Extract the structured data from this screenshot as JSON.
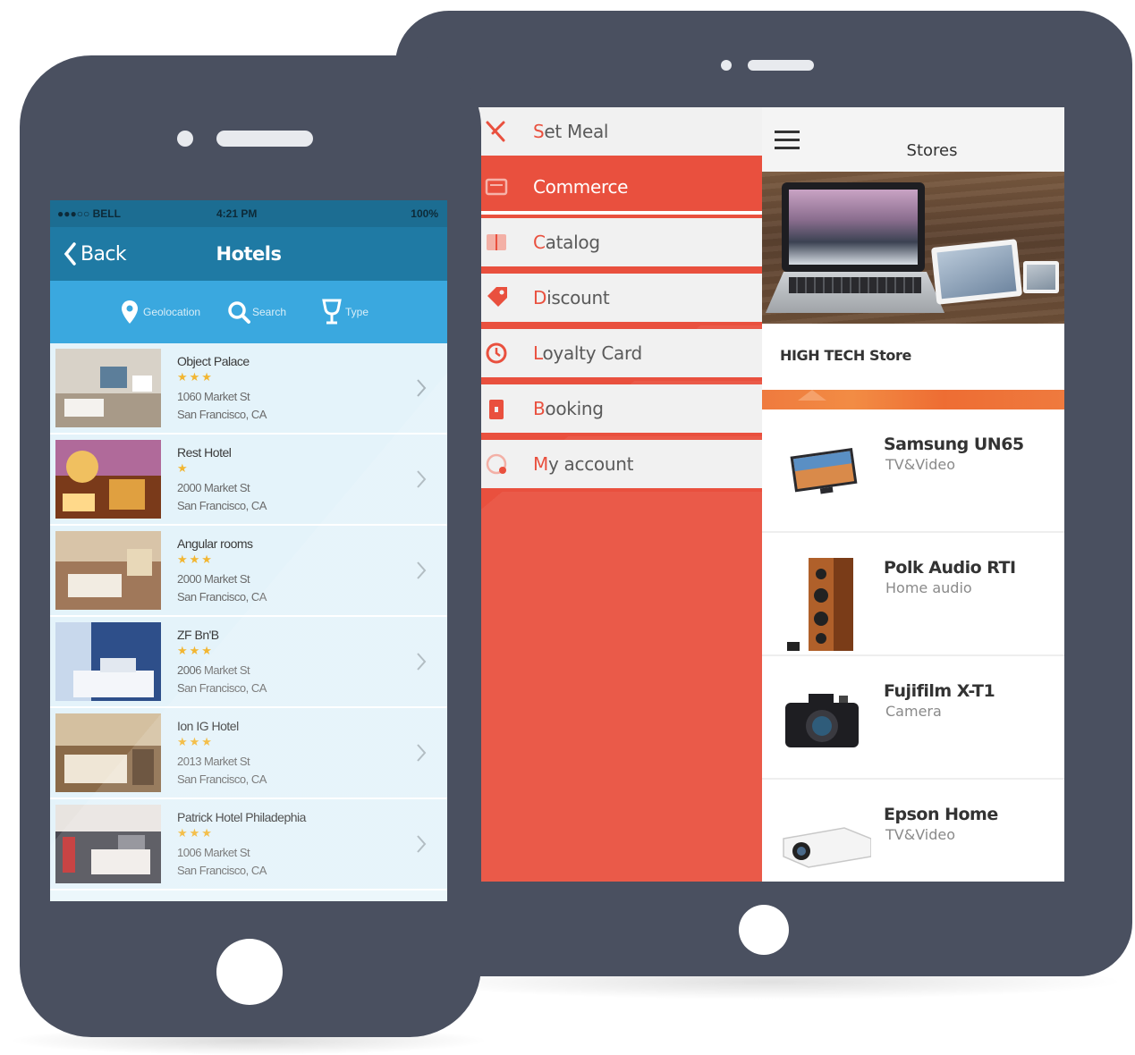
{
  "tablet": {
    "menu": {
      "items": [
        {
          "label": "Set Meal",
          "icon": "fork-knife-icon",
          "active": false
        },
        {
          "label": "Commerce",
          "icon": "cart-icon",
          "active": true
        },
        {
          "label": "Catalog",
          "icon": "book-icon",
          "active": false
        },
        {
          "label": "Discount",
          "icon": "tag-icon",
          "active": false
        },
        {
          "label": "Loyalty Card",
          "icon": "clock-icon",
          "active": false
        },
        {
          "label": "Booking",
          "icon": "calendar-icon",
          "active": false
        },
        {
          "label": "My account",
          "icon": "user-icon",
          "active": false
        }
      ]
    },
    "store": {
      "title": "Stores",
      "store_name": "HIGH TECH Store",
      "products": [
        {
          "name": "Samsung UN65",
          "category": "TV&Video",
          "icon": "tv-icon"
        },
        {
          "name": "Polk Audio RTI",
          "category": "Home audio",
          "icon": "speaker-icon"
        },
        {
          "name": "Fujifilm X-T1",
          "category": "Camera",
          "icon": "camera-icon"
        },
        {
          "name": "Epson Home",
          "category": "TV&Video",
          "icon": "projector-icon"
        }
      ]
    }
  },
  "phone": {
    "statusbar": {
      "carrier": "●●●○○ BELL ",
      "time": "4:21 PM",
      "battery": "100%"
    },
    "navbar": {
      "back_label": "Back",
      "title": "Hotels"
    },
    "toolbar": {
      "geolocation": "Geolocation",
      "search": "Search",
      "type": "Type"
    },
    "hotels": [
      {
        "name": "Object Palace",
        "stars": "★★★",
        "addr1": "1060 Market St",
        "addr2": "San Francisco, CA"
      },
      {
        "name": "Rest Hotel",
        "stars": "★",
        "addr1": "2000 Market St",
        "addr2": "San Francisco, CA"
      },
      {
        "name": "Angular rooms",
        "stars": "★★★",
        "addr1": "2000 Market St",
        "addr2": "San Francisco, CA"
      },
      {
        "name": "ZF Bn'B",
        "stars": "★★★",
        "addr1": "2006 Market St",
        "addr2": "San Francisco, CA"
      },
      {
        "name": "Ion IG Hotel",
        "stars": "★★★",
        "addr1": "2013 Market St",
        "addr2": "San Francisco, CA"
      },
      {
        "name": "Patrick Hotel Philadephia",
        "stars": "★★★",
        "addr1": "1006 Market St",
        "addr2": "San Francisco, CA"
      }
    ]
  },
  "colors": {
    "device_body": "#4a5060",
    "menu_red": "#e9503e",
    "phone_nav_blue": "#1f7aa4",
    "phone_toolbar_blue": "#3aa8df",
    "star_gold": "#f2b632",
    "strip_orange": "#ef7a3e"
  }
}
